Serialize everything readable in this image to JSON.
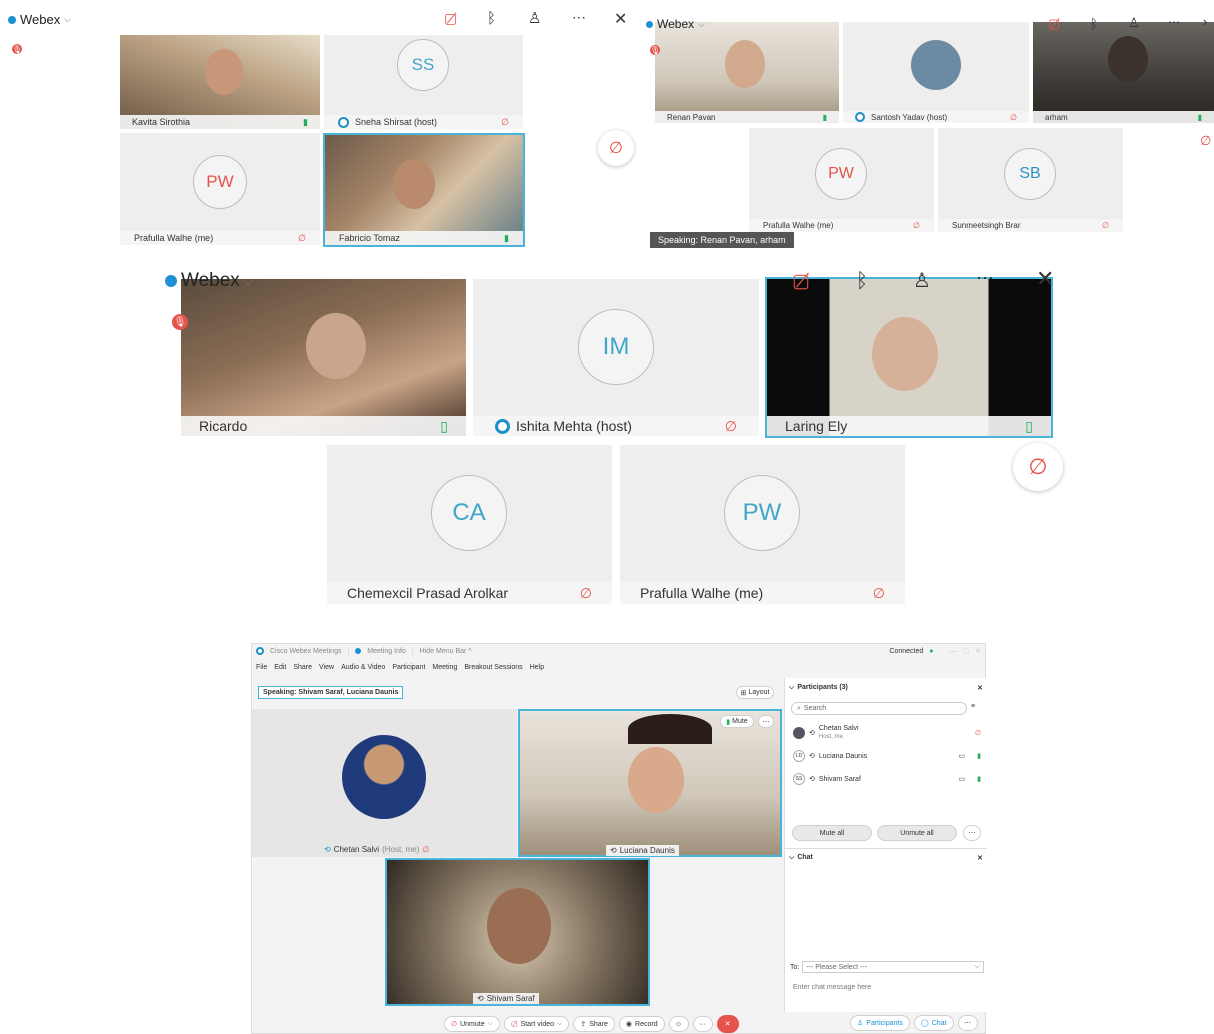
{
  "panel1": {
    "brand": "Webex",
    "tiles": [
      {
        "name": "Kavita Sirothia",
        "mic": "on"
      },
      {
        "name": "Sneha Shirsat (host)",
        "initials": "SS",
        "mic": "off"
      },
      {
        "name": "Prafulla Walhe (me)",
        "initials": "PW",
        "mic": "off"
      },
      {
        "name": "Fabricio Tomaz",
        "mic": "on"
      }
    ],
    "more_icon": "⋯",
    "close_icon": "✕"
  },
  "panel2": {
    "brand": "Webex",
    "tiles": [
      {
        "name": "Renan Pavan",
        "mic": "on"
      },
      {
        "name": "Santosh Yadav (host)",
        "mic": "off"
      },
      {
        "name": "arham",
        "mic": "on"
      },
      {
        "name": "Prafulla Walhe (me)",
        "initials": "PW",
        "mic": "off"
      },
      {
        "name": "Sunmeetsingh Brar",
        "initials": "SB",
        "mic": "off"
      }
    ],
    "speaking": "Speaking: Renan Pavan, arham"
  },
  "panel3": {
    "brand": "Webex",
    "tiles": [
      {
        "name": "Ricardo",
        "mic": "on"
      },
      {
        "name": "Ishita Mehta (host)",
        "initials": "IM",
        "mic": "off"
      },
      {
        "name": "Laring Ely",
        "mic": "on"
      },
      {
        "name": "Chemexcil Prasad Arolkar",
        "initials": "CA",
        "mic": "off"
      },
      {
        "name": "Prafulla Walhe (me)",
        "initials": "PW",
        "mic": "off"
      }
    ],
    "more_icon": "⋯",
    "close_icon": "✕"
  },
  "app": {
    "titlebar": {
      "app_name": "Cisco Webex Meetings",
      "meeting_info": "Meeting Info",
      "hide_menu": "Hide Menu Bar ^",
      "status": "Connected"
    },
    "menu": [
      "File",
      "Edit",
      "Share",
      "View",
      "Audio & Video",
      "Participant",
      "Meeting",
      "Breakout Sessions",
      "Help"
    ],
    "speaking": "Speaking: Shivam Saraf, Luciana Daunis",
    "layout_button": "Layout",
    "mute_button": "Mute",
    "tiles": [
      {
        "name": "Chetan Salvi",
        "suffix": "(Host, me)"
      },
      {
        "name": "Luciana Daunis"
      },
      {
        "name": "Shivam Saraf"
      }
    ],
    "controls": {
      "unmute": "Unmute",
      "start_video": "Start video",
      "share": "Share",
      "record": "Record",
      "more": "···",
      "participants": "Participants",
      "chat": "Chat"
    },
    "participants_panel": {
      "title": "Participants (3)",
      "search_placeholder": "Search",
      "list": [
        {
          "name": "Chetan Salvi",
          "role": "Host, me",
          "initials": ""
        },
        {
          "name": "Luciana Daunis",
          "role": "",
          "initials": "LD"
        },
        {
          "name": "Shivam Saraf",
          "role": "",
          "initials": "SS"
        }
      ],
      "mute_all": "Mute all",
      "unmute_all": "Unmute all"
    },
    "chat_panel": {
      "title": "Chat",
      "to_label": "To:",
      "to_select": "--- Please Select ---",
      "input_placeholder": "Enter chat message here"
    }
  },
  "colors": {
    "accent": "#1e90d6",
    "mute_red": "#e5534b",
    "mic_green": "#1fae5b",
    "active_border": "#4ab3d8"
  }
}
